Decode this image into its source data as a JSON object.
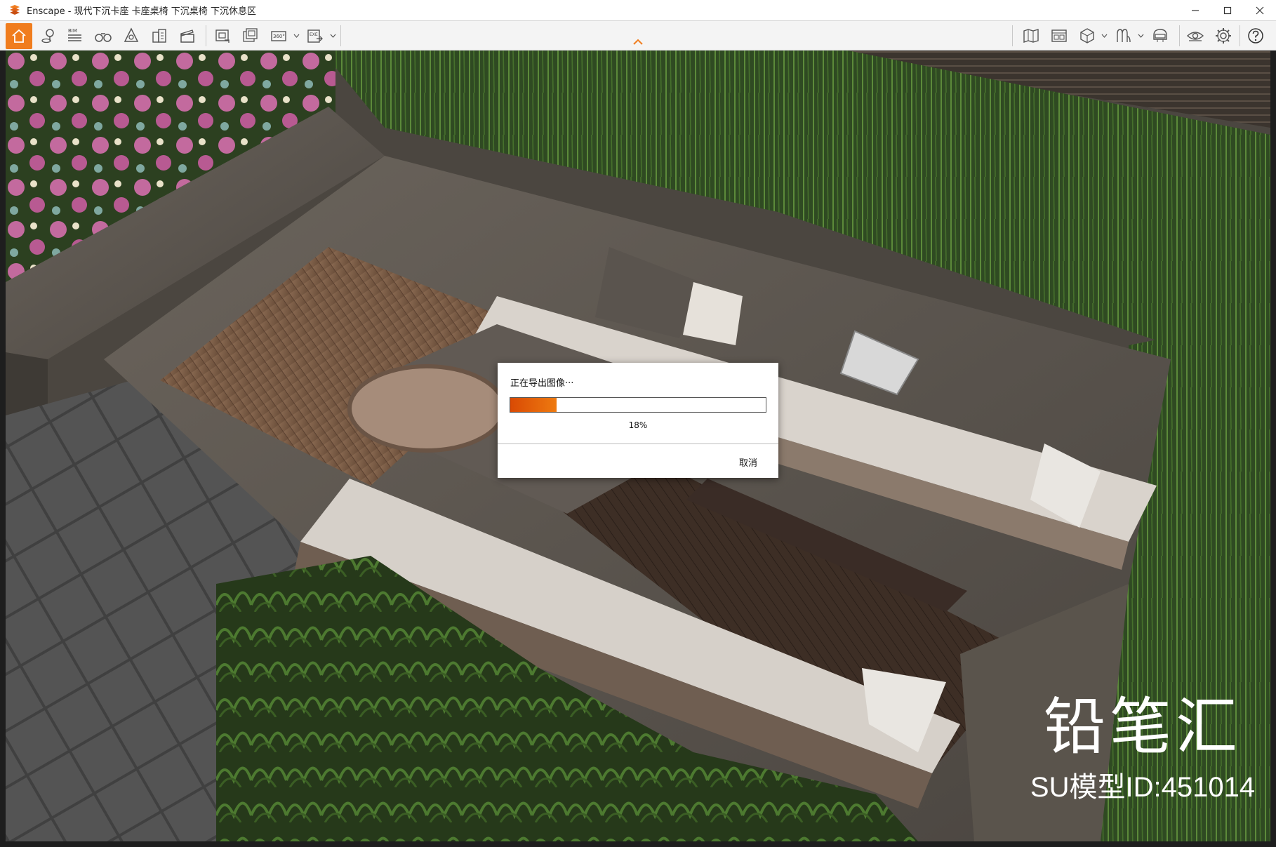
{
  "window": {
    "title": "Enscape - 现代下沉卡座 卡座桌椅 下沉桌椅 下沉休息区",
    "accent_color": "#f07d1e"
  },
  "toolbar": {
    "left_tools": [
      {
        "icon": "home-icon",
        "active": true
      },
      {
        "icon": "map-pin-icon"
      },
      {
        "icon": "bim-icon",
        "label": "BIM"
      },
      {
        "icon": "binoculars-icon"
      },
      {
        "icon": "perspective-icon"
      },
      {
        "icon": "buildings-icon"
      },
      {
        "icon": "clapperboard-icon"
      },
      {
        "icon": "screenshot-export-icon"
      },
      {
        "icon": "batch-export-icon"
      },
      {
        "icon": "panorama-360-icon",
        "label": "360°"
      },
      {
        "icon": "exe-export-icon",
        "label": "EXE"
      }
    ],
    "right_tools": [
      {
        "icon": "map-view-icon"
      },
      {
        "icon": "view-management-icon"
      },
      {
        "icon": "asset-cube-icon"
      },
      {
        "icon": "material-icon"
      },
      {
        "icon": "helmet-vr-icon"
      },
      {
        "icon": "eye-visual-settings-icon"
      },
      {
        "icon": "gear-icon"
      },
      {
        "icon": "help-icon"
      }
    ]
  },
  "viewport": {
    "watermark_logo": "铅笔汇",
    "watermark_id": "SU模型ID:451014"
  },
  "dialog": {
    "title": "正在导出图像···",
    "progress_percent": 18,
    "progress_label": "18%",
    "cancel_label": "取消",
    "progress_color": "#e15a0a"
  }
}
